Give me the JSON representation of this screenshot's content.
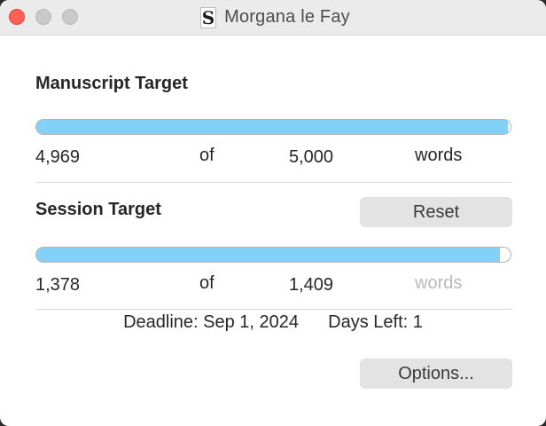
{
  "window": {
    "title": "Morgana le Fay"
  },
  "manuscript": {
    "label": "Manuscript Target",
    "current": "4,969",
    "of": "of",
    "target": "5,000",
    "unit": "words",
    "progress": 0.994
  },
  "session": {
    "label": "Session Target",
    "reset_label": "Reset",
    "current": "1,378",
    "of": "of",
    "target": "1,409",
    "unit": "words",
    "progress": 0.978
  },
  "deadline": {
    "deadline_text": "Deadline: Sep 1, 2024",
    "days_left_text": "Days Left: 1"
  },
  "footer": {
    "options_label": "Options..."
  },
  "colors": {
    "progress_fill": "#83d1f8",
    "close_button": "#ff5f57"
  },
  "icons": {
    "document": "scrivener-document-icon"
  }
}
